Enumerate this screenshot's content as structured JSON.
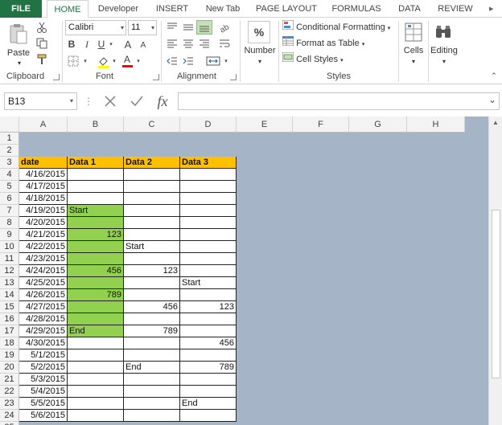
{
  "tabs": [
    {
      "label": "FILE"
    },
    {
      "label": "HOME"
    },
    {
      "label": "Developer"
    },
    {
      "label": "INSERT"
    },
    {
      "label": "New Tab"
    },
    {
      "label": "PAGE LAYOUT"
    },
    {
      "label": "FORMULAS"
    },
    {
      "label": "DATA"
    },
    {
      "label": "REVIEW"
    }
  ],
  "ribbon": {
    "clipboard": {
      "label": "Clipboard",
      "paste": "Paste"
    },
    "font": {
      "label": "Font",
      "name": "Calibri",
      "size": "11",
      "bold": "B",
      "italic": "I",
      "underline": "U",
      "grow": "A",
      "shrink": "A",
      "font_color": "A"
    },
    "alignment": {
      "label": "Alignment"
    },
    "number": {
      "label": "Number",
      "symbol": "%"
    },
    "styles": {
      "label": "Styles",
      "conditional": "Conditional Formatting",
      "format_table": "Format as Table",
      "cell_styles": "Cell Styles"
    },
    "cells": {
      "label": "Cells"
    },
    "editing": {
      "label": "Editing"
    }
  },
  "formula_bar": {
    "name_box": "B13",
    "fx": "fx",
    "value": ""
  },
  "columns": [
    "A",
    "B",
    "C",
    "D",
    "E",
    "F",
    "G",
    "H"
  ],
  "rows": [
    "1",
    "2",
    "3",
    "4",
    "5",
    "6",
    "7",
    "8",
    "9",
    "10",
    "11",
    "12",
    "13",
    "14",
    "15",
    "16",
    "17",
    "18",
    "19",
    "20",
    "21",
    "22",
    "23",
    "24",
    "25"
  ],
  "table": {
    "headers": [
      "date",
      "Data 1",
      "Data 2",
      "Data 3"
    ],
    "rows": [
      {
        "date": "4/16/2015",
        "b": "",
        "c": "",
        "d": ""
      },
      {
        "date": "4/17/2015",
        "b": "",
        "c": "",
        "d": ""
      },
      {
        "date": "4/18/2015",
        "b": "",
        "c": "",
        "d": ""
      },
      {
        "date": "4/19/2015",
        "b": "Start",
        "c": "",
        "d": ""
      },
      {
        "date": "4/20/2015",
        "b": "",
        "c": "",
        "d": ""
      },
      {
        "date": "4/21/2015",
        "b": "123",
        "c": "",
        "d": ""
      },
      {
        "date": "4/22/2015",
        "b": "",
        "c": "Start",
        "d": ""
      },
      {
        "date": "4/23/2015",
        "b": "",
        "c": "",
        "d": ""
      },
      {
        "date": "4/24/2015",
        "b": "456",
        "c": "123",
        "d": ""
      },
      {
        "date": "4/25/2015",
        "b": "",
        "c": "",
        "d": "Start"
      },
      {
        "date": "4/26/2015",
        "b": "789",
        "c": "",
        "d": ""
      },
      {
        "date": "4/27/2015",
        "b": "",
        "c": "456",
        "d": "123"
      },
      {
        "date": "4/28/2015",
        "b": "",
        "c": "",
        "d": ""
      },
      {
        "date": "4/29/2015",
        "b": "End",
        "c": "789",
        "d": ""
      },
      {
        "date": "4/30/2015",
        "b": "",
        "c": "",
        "d": "456"
      },
      {
        "date": "5/1/2015",
        "b": "",
        "c": "",
        "d": ""
      },
      {
        "date": "5/2/2015",
        "b": "",
        "c": "End",
        "d": "789"
      },
      {
        "date": "5/3/2015",
        "b": "",
        "c": "",
        "d": ""
      },
      {
        "date": "5/4/2015",
        "b": "",
        "c": "",
        "d": ""
      },
      {
        "date": "5/5/2015",
        "b": "",
        "c": "",
        "d": "End"
      },
      {
        "date": "5/6/2015",
        "b": "",
        "c": "",
        "d": ""
      }
    ],
    "green_rows_b": [
      3,
      4,
      5,
      6,
      7,
      8,
      9,
      10,
      11,
      12,
      13
    ]
  },
  "colors": {
    "excel_green": "#217346",
    "header_fill": "#ffc000",
    "highlight_fill": "#92d050",
    "sheet_background": "#a6b4c8"
  }
}
